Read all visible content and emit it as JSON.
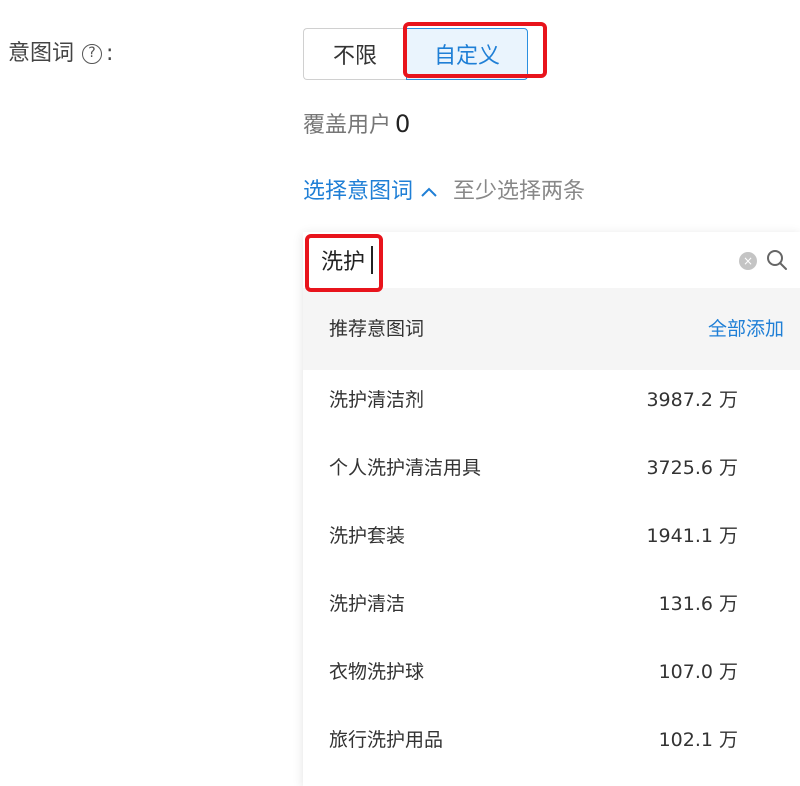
{
  "form": {
    "label": "意图词",
    "help_icon": "?",
    "label_suffix": ":"
  },
  "segment": {
    "options": [
      {
        "label": "不限",
        "selected": false
      },
      {
        "label": "自定义",
        "selected": true
      }
    ]
  },
  "coverage": {
    "label": "覆盖用户",
    "count": "0"
  },
  "selector": {
    "link_label": "选择意图词",
    "hint": "至少选择两条",
    "icon": "chevron-up-icon"
  },
  "search": {
    "value": "洗护",
    "clear_icon": "×",
    "search_icon": "search-icon"
  },
  "recommend": {
    "title": "推荐意图词",
    "add_all_label": "全部添加",
    "items": [
      {
        "name": "洗护清洁剂",
        "count": "3987.2 万"
      },
      {
        "name": "个人洗护清洁用具",
        "count": "3725.6 万"
      },
      {
        "name": "洗护套装",
        "count": "1941.1 万"
      },
      {
        "name": "洗护清洁",
        "count": "131.6 万"
      },
      {
        "name": "衣物洗护球",
        "count": "107.0 万"
      },
      {
        "name": "旅行洗护用品",
        "count": "102.1 万"
      }
    ]
  },
  "colors": {
    "accent": "#1f7fd6",
    "highlight_box": "#e8141c",
    "selected_bg": "#eaf4fd"
  }
}
